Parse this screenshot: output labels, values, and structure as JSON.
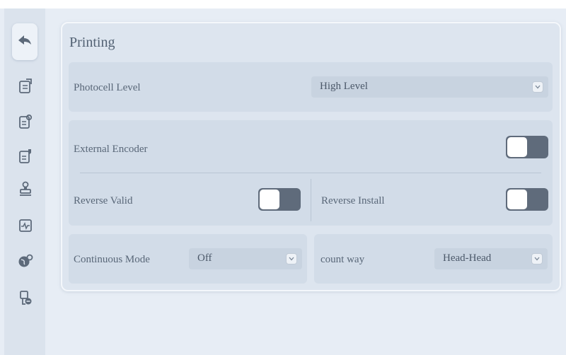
{
  "sidebar": {
    "back_icon": "back-arrow-icon",
    "items": [
      {
        "icon": "document-print-icon"
      },
      {
        "icon": "document-settings-icon"
      },
      {
        "icon": "document-edit-icon"
      },
      {
        "icon": "printer-stamp-icon"
      },
      {
        "icon": "monitor-waveform-icon"
      },
      {
        "icon": "globe-gear-icon"
      },
      {
        "icon": "cartridge-minus-icon"
      }
    ]
  },
  "panel": {
    "title": "Printing",
    "photocell": {
      "label": "Photocell Level",
      "value": "High Level"
    },
    "encoder": {
      "external_label": "External Encoder",
      "external_on": false,
      "reverse_valid_label": "Reverse Valid",
      "reverse_valid_on": false,
      "reverse_install_label": "Reverse Install",
      "reverse_install_on": false
    },
    "continuous": {
      "label": "Continuous Mode",
      "value": "Off"
    },
    "count": {
      "label": "count way",
      "value": "Head-Head"
    }
  }
}
